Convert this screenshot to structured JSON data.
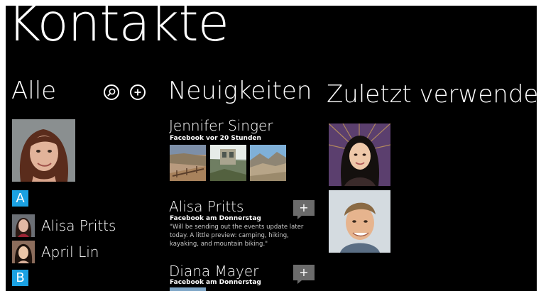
{
  "app": {
    "title": "Kontakte"
  },
  "all": {
    "title": "Alle",
    "search_icon": "search-icon",
    "add_icon": "add-icon",
    "groups": [
      {
        "letter": "A",
        "contacts": [
          {
            "name": "Alisa Pritts"
          },
          {
            "name": "April Lin"
          }
        ]
      },
      {
        "letter": "B",
        "contacts": []
      }
    ]
  },
  "news": {
    "title": "Neuigkeiten",
    "items": [
      {
        "name": "Jennifer Singer",
        "source": "Facebook vor 20 Stunden"
      },
      {
        "name": "Alisa Pritts",
        "source": "Facebook am Donnerstag",
        "text": "\"Will be sending out the events update later today. A little preview: camping, hiking, kayaking, and mountain biking.\"",
        "comment_label": "+"
      },
      {
        "name": "Diana Mayer",
        "source": "Facebook am Donnerstag",
        "comment_label": "+"
      }
    ]
  },
  "recent": {
    "title": "Zuletzt verwendet"
  },
  "colors": {
    "background": "#000000",
    "accent": "#1ba1e2",
    "comment_button": "#6b6b6b"
  }
}
